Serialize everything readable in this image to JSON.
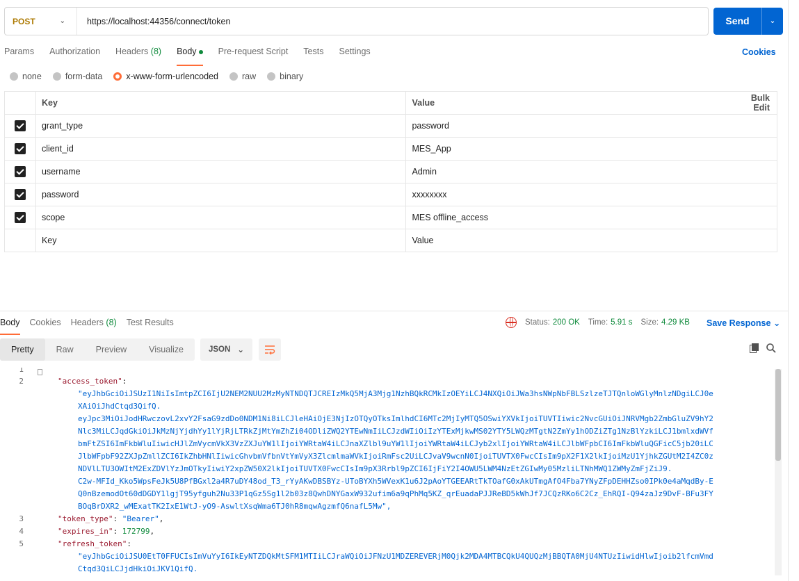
{
  "request": {
    "method": "POST",
    "url": "https://localhost:44356/connect/token",
    "send_label": "Send"
  },
  "request_tabs": [
    {
      "label": "Params"
    },
    {
      "label": "Authorization"
    },
    {
      "label": "Headers",
      "count": "(8)"
    },
    {
      "label": "Body"
    },
    {
      "label": "Pre-request Script"
    },
    {
      "label": "Tests"
    },
    {
      "label": "Settings"
    }
  ],
  "cookies_label": "Cookies",
  "body_types": [
    "none",
    "form-data",
    "x-www-form-urlencoded",
    "raw",
    "binary"
  ],
  "selected_body_type": "x-www-form-urlencoded",
  "params_table": {
    "headers": {
      "key": "Key",
      "value": "Value",
      "bulk_edit": "Bulk Edit"
    },
    "rows": [
      {
        "key": "grant_type",
        "value": "password",
        "checked": true
      },
      {
        "key": "client_id",
        "value": "MES_App",
        "checked": true
      },
      {
        "key": "username",
        "value": "Admin",
        "checked": true
      },
      {
        "key": "password",
        "value": "xxxxxxxx",
        "checked": true
      },
      {
        "key": "scope",
        "value": "MES offline_access",
        "checked": true
      }
    ],
    "placeholder": {
      "key": "Key",
      "value": "Value"
    }
  },
  "response": {
    "tabs": [
      {
        "label": "Body"
      },
      {
        "label": "Cookies"
      },
      {
        "label": "Headers",
        "count": "(8)"
      },
      {
        "label": "Test Results"
      }
    ],
    "status_label": "Status:",
    "status_value": "200 OK",
    "time_label": "Time:",
    "time_value": "5.91 s",
    "size_label": "Size:",
    "size_value": "4.29 KB",
    "save_label": "Save Response",
    "view_modes": [
      "Pretty",
      "Raw",
      "Preview",
      "Visualize"
    ],
    "format": "JSON",
    "line_numbers": [
      "1",
      "2",
      "3",
      "4",
      "5"
    ],
    "json": {
      "access_token_key": "\"access_token\"",
      "access_token_lines": [
        "\"eyJhbGciOiJSUzI1NiIsImtpZCI6IjU2NEM2NUU2MzMyNTNDQTJCREIzMkQ5MjA3Mjg1NzhBQkRCMkIzOEYiLCJ4NXQiOiJWa3hsNWpNbFBLSzlzeTJTQnloWGlyMnlzNDgiLCJ0e",
        "XAiOiJhdCtqd3QifQ.",
        "eyJpc3MiOiJodHRwczovL2xvY2FsaG9zdDo0NDM1Ni8iLCJleHAiOjE3NjIzOTQyOTksImlhdCI6MTc2MjIyMTQ5OSwiYXVkIjoiTUVTIiwic2NvcGUiOiJNRVMgb2ZmbGluZV9hY2",
        "Nlc3MiLCJqdGkiOiJkMzNjYjdhYy1lYjRjLTRkZjMtYmZhZi04ODliZWQ2YTEwNmIiLCJzdWIiOiIzYTExMjkwMS02YTY5LWQzMTgtN2ZmYy1hODZiZTg1NzBlYzkiLCJ1bmlxdWVf",
        "bmFtZSI6ImFkbWluIiwicHJlZmVycmVkX3VzZXJuYW1lIjoiYWRtaW4iLCJnaXZlbl9uYW1lIjoiYWRtaW4iLCJyb2xlIjoiYWRtaW4iLCJlbWFpbCI6ImFkbWluQGFicC5jb20iLC",
        "JlbWFpbF92ZXJpZmllZCI6IkZhbHNlIiwicGhvbmVfbnVtYmVyX3ZlcmlmaWVkIjoiRmFsc2UiLCJvaV9wcnN0IjoiTUVTX0FwcCIsIm9pX2F1X2lkIjoiMzU1YjhkZGUtM2I4ZC0z",
        "NDVlLTU3OWItM2ExZDVlYzJmOTkyIiwiY2xpZW50X2lkIjoiTUVTX0FwcCIsIm9pX3Rrbl9pZCI6IjFiY2I4OWU5LWM4NzEtZGIwMy05MzliLTNhMWQ1ZWMyZmFjZiJ9.",
        "C2w-MFId_Kko5WpsFeJk5U8PfBGxl2a4R7uDY48od_T3_rYyAKwDBSBYz-UToBYXh5WVexK1u6J2pAoYTGEEARtTkTOafG0xAkUTmgAfO4Fba7YNyZFpDEHHZso0IPk0e4aMqdBy-E",
        "Q0nBzemodOt60dDGDY1lgjT95yfguh2Nu33P1qGz5Sg1l2b03z8QwhDNYGaxW932ufim6a9qPhMq5KZ_qrEuadaPJJReBD5kWhJf7JCQzRKo6C2Cz_EhRQI-Q94zaJz9DvF-BFu3FY",
        "BOqBrDXR2_wMExatTK2IxE1WtJ-yO9-AswltXsqWma6TJ0hR8mqwAgzmfQ6nafL5Mw\","
      ],
      "token_type_key": "\"token_type\"",
      "token_type_value": "\"Bearer\"",
      "expires_in_key": "\"expires_in\"",
      "expires_in_value": "172799",
      "refresh_token_key": "\"refresh_token\"",
      "refresh_token_lines": [
        "\"eyJhbGciOiJSU0EtT0FFUCIsImVuYyI6IkEyNTZDQkMtSFM1MTIiLCJraWQiOiJFNzU1MDZEREVERjM0Qjk2MDA4MTBCQkU4QUQzMjBBQTA0MjU4NTUzIiwidHlwIjoib2lfcmVmd",
        "Ctqd3QiLCJjdHkiOiJKV1QifQ."
      ]
    }
  },
  "colors": {
    "accent": "#ff6c37",
    "primary": "#0265d2",
    "method": "#ad7a03",
    "success": "#0f8a3c",
    "json_key": "#9b1c31"
  }
}
